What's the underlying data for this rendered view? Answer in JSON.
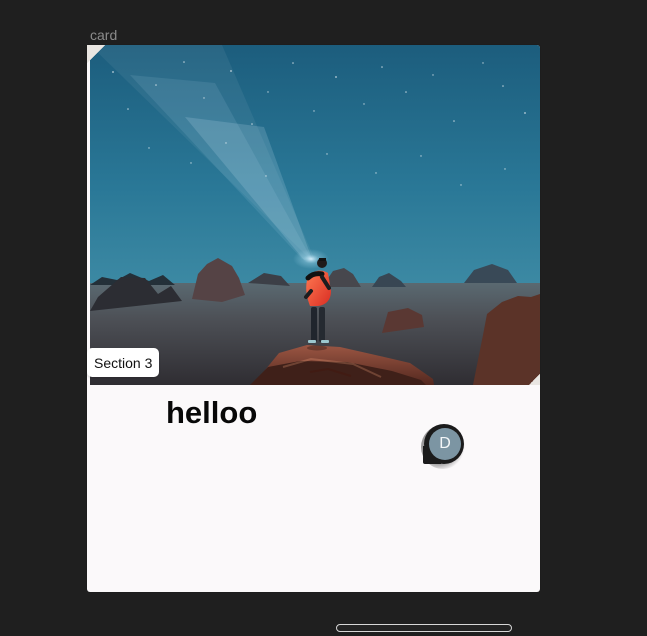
{
  "frame": {
    "label": "card"
  },
  "card": {
    "section_label": "Section 3",
    "title": "helloo",
    "avatar": {
      "initial": "D",
      "color": "#7c95a3"
    }
  },
  "scrollbar": {
    "label": ""
  },
  "colors": {
    "background": "#1f1f1f",
    "card_surface": "#fbf9fa",
    "title": "#080808",
    "frame_label": "#8b8b8b"
  }
}
